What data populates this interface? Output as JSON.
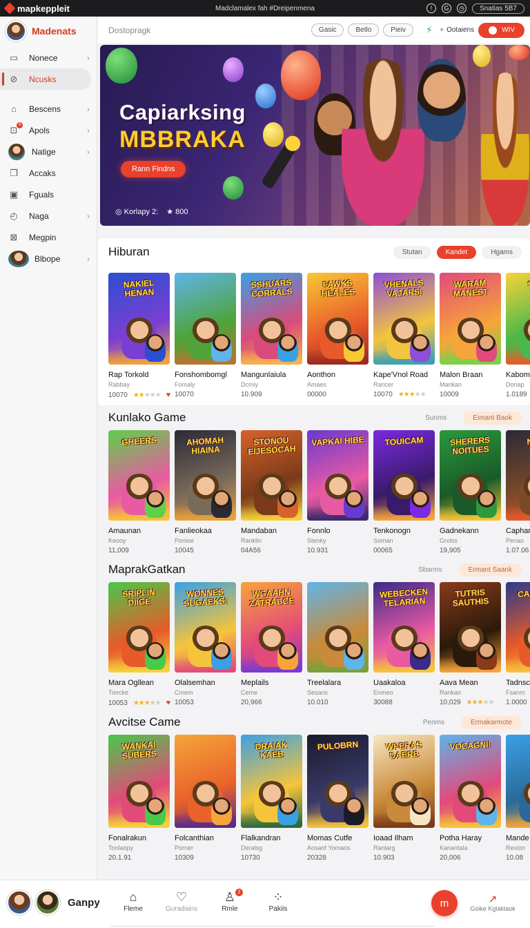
{
  "topbar": {
    "brand": "mapkeppleit",
    "center_text": "Madclamalex fah #Dreipenmena",
    "status_pill": "Snatias 5B7"
  },
  "sidebar": {
    "brand_name": "Madenats",
    "items": [
      {
        "label": "Nonece",
        "icon": "tablet-icon",
        "chevron": true,
        "active": false
      },
      {
        "label": "Ncusks",
        "icon": "link-icon",
        "chevron": false,
        "active": true
      },
      {
        "label": "Bescens",
        "icon": "home-icon",
        "chevron": true,
        "active": false
      },
      {
        "label": "Apols",
        "icon": "gift-icon",
        "chevron": true,
        "active": false,
        "badge": "4"
      },
      {
        "label": "Natige",
        "icon": "avatar-icon",
        "chevron": true,
        "active": false
      },
      {
        "label": "Accaks",
        "icon": "copy-icon",
        "chevron": false,
        "active": false
      },
      {
        "label": "Fguals",
        "icon": "image-icon",
        "chevron": false,
        "active": false
      },
      {
        "label": "Naga",
        "icon": "compass-icon",
        "chevron": true,
        "active": false
      },
      {
        "label": "Megpin",
        "icon": "map-icon",
        "chevron": false,
        "active": false
      },
      {
        "label": "Blbope",
        "icon": "group-avatar-icon",
        "chevron": true,
        "active": false
      }
    ]
  },
  "search": {
    "placeholder": "Dostopragk",
    "chips": [
      "Gasic",
      "Betlo",
      "Pieiv"
    ],
    "label": "Ootaiens",
    "cta": "WIV"
  },
  "hero": {
    "title_line1": "Capiarksing",
    "title_line2": "MBBRAKA",
    "button": "Rann Findns",
    "meta_left": "Korlapy 2:",
    "meta_rating": "800"
  },
  "sections": [
    {
      "title": "Hiburan",
      "tabs": [
        "Stutan",
        "Kandet",
        "Hgams"
      ],
      "active_tab": 1,
      "games": [
        {
          "title": "Rap Torkold",
          "sub": "Rabbay",
          "num": "10070",
          "stars": 2,
          "heart": true,
          "art_title": "NAKIEL HENAN",
          "palette": [
            "#2b4fd0",
            "#7a3fd2",
            "#f0a33a"
          ]
        },
        {
          "title": "Fonshombomgl",
          "sub": "Fomaly",
          "num": "10070",
          "stars": 0,
          "heart": false,
          "art_title": "",
          "palette": [
            "#5fb4ea",
            "#4fa33a",
            "#b5762e"
          ]
        },
        {
          "title": "Mangunlaiula",
          "sub": "Dcmiy",
          "num": "10.909",
          "stars": 0,
          "heart": false,
          "art_title": "SSHUARS CORRALS",
          "palette": [
            "#3aa0e4",
            "#d94b7a",
            "#f6b44a"
          ]
        },
        {
          "title": "Aonthon",
          "sub": "Amaes",
          "num": "00000",
          "stars": 0,
          "heart": false,
          "art_title": "FAWKS HEALES",
          "palette": [
            "#f7c835",
            "#e85a2a",
            "#9a2a22"
          ]
        },
        {
          "title": "Kape'Vnol Road",
          "sub": "Raricer",
          "num": "10070",
          "stars": 3,
          "heart": false,
          "art_title": "VHENALS VAJARSI",
          "palette": [
            "#8d4ed8",
            "#f3c43d",
            "#3aa0b4"
          ]
        },
        {
          "title": "Malon Braan",
          "sub": "Marikan",
          "num": "10009",
          "stars": 0,
          "heart": false,
          "art_title": "WARAM MANEST",
          "palette": [
            "#e24a7a",
            "#f6a53a",
            "#7ad04a"
          ]
        },
        {
          "title": "Kabom",
          "sub": "Donap",
          "num": "1.0189",
          "stars": 0,
          "heart": false,
          "art_title": "SUB",
          "palette": [
            "#f6d33a",
            "#4ab84a",
            "#e85a2a"
          ]
        }
      ]
    },
    {
      "title": "Kunlako Game",
      "link": "Sunms",
      "soft_button": "Eimant Baok",
      "games": [
        {
          "title": "Amaunan",
          "sub": "Keooy",
          "num": "11,009",
          "stars": 0,
          "heart": false,
          "art_title": "GHEERS",
          "palette": [
            "#5fd04a",
            "#e85aa2",
            "#f6c43a"
          ]
        },
        {
          "title": "Fanlieokaa",
          "sub": "Ponioe",
          "num": "10045",
          "stars": 0,
          "heart": false,
          "art_title": "AHOMAH HIAINA",
          "palette": [
            "#2a2a36",
            "#7a6a5a",
            "#e8a23a"
          ]
        },
        {
          "title": "Mandaban",
          "sub": "Ranklin",
          "num": "04A56",
          "stars": 0,
          "heart": false,
          "art_title": "STONOU EIJESOCAH",
          "palette": [
            "#d9622a",
            "#7a3a1a",
            "#f6d33a"
          ]
        },
        {
          "title": "Fonnlo",
          "sub": "Stenky",
          "num": "10.931",
          "stars": 0,
          "heart": false,
          "art_title": "VAPKAI HIBE",
          "palette": [
            "#6a3ad0",
            "#e85aa2",
            "#3a2a6a"
          ]
        },
        {
          "title": "Tenkonogn",
          "sub": "Soman",
          "num": "00065",
          "stars": 0,
          "heart": false,
          "art_title": "TOUICAM",
          "palette": [
            "#7a2ae0",
            "#3a1a6a",
            "#f6a53a"
          ]
        },
        {
          "title": "Gadnekann",
          "sub": "Grolss",
          "num": "19,905",
          "stars": 0,
          "heart": false,
          "art_title": "SHERERS NOITUES",
          "palette": [
            "#2a9a3a",
            "#1a5a2a",
            "#f6c43a"
          ]
        },
        {
          "title": "Caphan",
          "sub": "Penao",
          "num": "1.07.06",
          "stars": 0,
          "heart": false,
          "art_title": "NISV",
          "palette": [
            "#2a2a36",
            "#7a4a2a",
            "#e85a2a"
          ]
        }
      ]
    },
    {
      "title": "MaprakGatkan",
      "link": "Sbarms",
      "soft_button": "Ermant Saank",
      "games": [
        {
          "title": "Mara Ogllean",
          "sub": "Tiorcke",
          "num": "10053",
          "stars": 3,
          "heart": true,
          "art_title": "SRIPLIN DIIGE",
          "palette": [
            "#4ac84a",
            "#e85a2a",
            "#f6d33a"
          ]
        },
        {
          "title": "Olalsemhan",
          "sub": "Cmem",
          "num": "10053",
          "stars": 0,
          "heart": false,
          "art_title": "WONNES SUGAEKS!",
          "palette": [
            "#3aa0e4",
            "#f6c43a",
            "#e24a7a"
          ]
        },
        {
          "title": "Meplails",
          "sub": "Ceme",
          "num": "20,966",
          "stars": 0,
          "heart": false,
          "art_title": "WGAAHN ZATRABCE",
          "palette": [
            "#f6a53a",
            "#e24a7a",
            "#7a3ad0"
          ]
        },
        {
          "title": "Treelalara",
          "sub": "Sesans",
          "num": "10.010",
          "stars": 0,
          "heart": false,
          "art_title": "",
          "palette": [
            "#5fb4ea",
            "#c98a3a",
            "#7aa03a"
          ]
        },
        {
          "title": "Uaakaloa",
          "sub": "Enmeo",
          "num": "30088",
          "stars": 0,
          "heart": false,
          "art_title": "WEBECKEN TELARIAN",
          "palette": [
            "#3a2a8a",
            "#e85aa2",
            "#f6c43a"
          ]
        },
        {
          "title": "Aava Mean",
          "sub": "Rankan",
          "num": "10,029",
          "stars": 3,
          "heart": false,
          "art_title": "TUTRIS SAUTHIS",
          "palette": [
            "#8a3a1a",
            "#2a1a0a",
            "#f6a53a"
          ]
        },
        {
          "title": "Tadnsc",
          "sub": "Fsanm",
          "num": "1.0000",
          "stars": 0,
          "heart": false,
          "art_title": "CAI AELL",
          "palette": [
            "#2a3a8a",
            "#e85a2a",
            "#f6c43a"
          ]
        }
      ]
    },
    {
      "title": "Avcitse Came",
      "link": "Penms",
      "soft_button": "Ermakarmote",
      "games": [
        {
          "title": "Fonalrakun",
          "sub": "Tonlaopy",
          "num": "20.1.91",
          "stars": 0,
          "heart": false,
          "art_title": "WANKAI SUBERS",
          "palette": [
            "#4ac84a",
            "#e24a7a",
            "#f6d33a"
          ]
        },
        {
          "title": "Folcanthian",
          "sub": "Porner",
          "num": "10309",
          "stars": 0,
          "heart": false,
          "art_title": "",
          "palette": [
            "#f6a53a",
            "#e8622a",
            "#5a2a8a"
          ]
        },
        {
          "title": "Flalkandran",
          "sub": "Deralsg",
          "num": "10730",
          "stars": 0,
          "heart": false,
          "art_title": "DRAIAK KAEB",
          "palette": [
            "#3aa0e4",
            "#f6c43a",
            "#2a6a3a"
          ]
        },
        {
          "title": "Momas Cutfe",
          "sub": "Aosanf Yomaos",
          "num": "20328",
          "stars": 0,
          "heart": false,
          "art_title": "PULOBRN",
          "palette": [
            "#1a1a2a",
            "#3a3a6a",
            "#f6c43a"
          ]
        },
        {
          "title": "Ioaad Ilham",
          "sub": "Ranlarg",
          "num": "10.903",
          "stars": 0,
          "heart": false,
          "art_title": "WPERAS DAERB",
          "palette": [
            "#f6e6c3",
            "#c98a3a",
            "#7a3a1a"
          ]
        },
        {
          "title": "Potha Haray",
          "sub": "Kanantala",
          "num": "20,006",
          "stars": 0,
          "heart": false,
          "art_title": "VOCAGNI!",
          "palette": [
            "#5fb4ea",
            "#e24a7a",
            "#f6c43a"
          ]
        },
        {
          "title": "Mande",
          "sub": "Rexion",
          "num": "10.08",
          "stars": 0,
          "heart": false,
          "art_title": "",
          "palette": [
            "#3aa0e4",
            "#2a6a9a",
            "#f6a53a"
          ]
        }
      ]
    }
  ],
  "bottombar": {
    "user_name": "Ganpy",
    "items": [
      {
        "label": "Fleme",
        "icon": "home-icon",
        "muted": false
      },
      {
        "label": "Guradains",
        "icon": "heart-icon",
        "muted": true
      },
      {
        "label": "Rmle",
        "icon": "user-icon",
        "muted": false,
        "badge": "2"
      },
      {
        "label": "Pakiis",
        "icon": "grid-icon",
        "muted": false
      }
    ],
    "fab_label": "m",
    "right_label": "Goike Kglaktaok"
  },
  "colors": {
    "accent": "#e8412c",
    "accent_dark": "#d63a22",
    "star": "#f0b31b"
  }
}
